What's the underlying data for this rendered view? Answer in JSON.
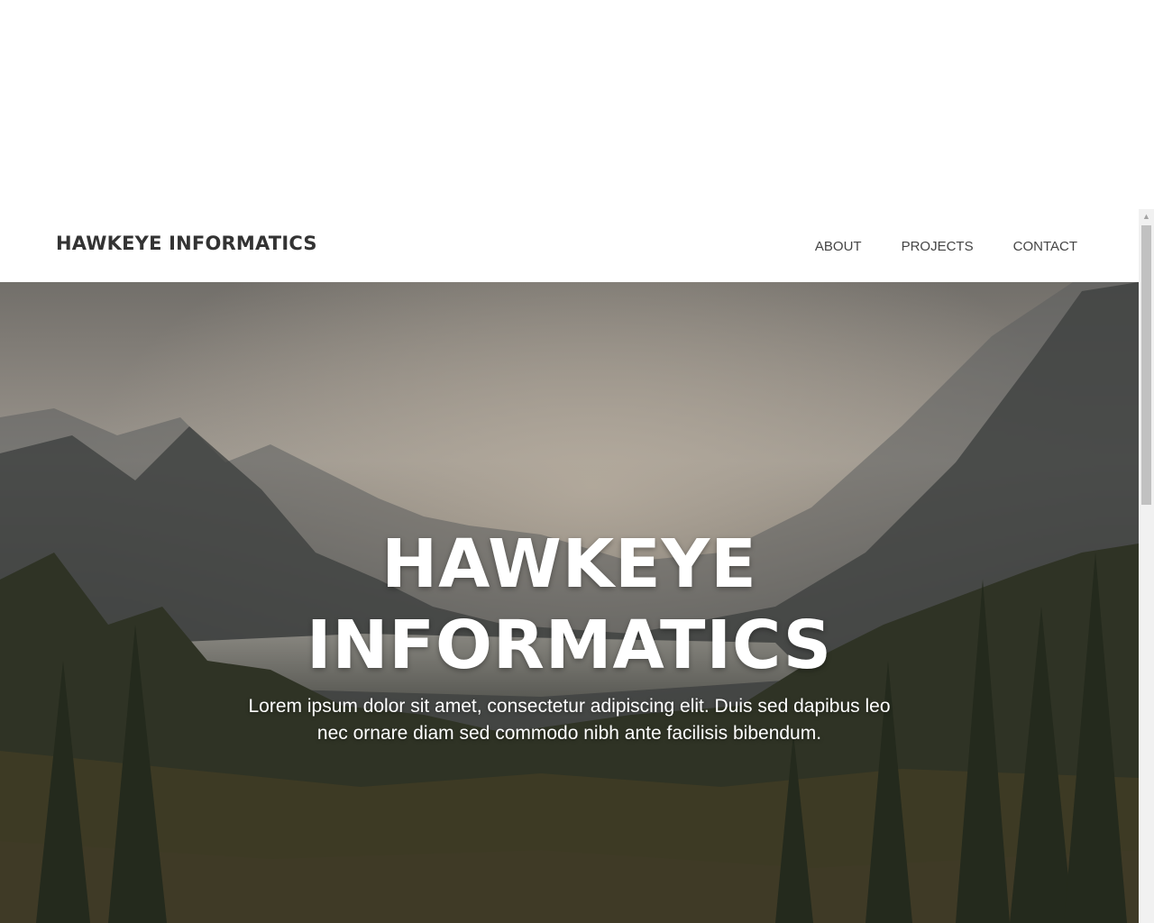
{
  "navbar": {
    "brand": "HAWKEYE INFORMATICS",
    "links": [
      {
        "label": "ABOUT"
      },
      {
        "label": "PROJECTS"
      },
      {
        "label": "CONTACT"
      }
    ]
  },
  "hero": {
    "title_line1": "HAWKEYE",
    "title_line2": "INFORMATICS",
    "text": "Lorem ipsum dolor sit amet, consectetur adipiscing elit. Duis sed dapibus leo nec ornare diam sed commodo nibh ante facilisis bibendum.",
    "background": "mountain-lake-forest-landscape"
  },
  "scrollbar": {
    "up_icon": "chevron-up-icon"
  },
  "colors": {
    "brand_text": "#333333",
    "nav_text": "#444444",
    "hero_text": "#ffffff"
  }
}
